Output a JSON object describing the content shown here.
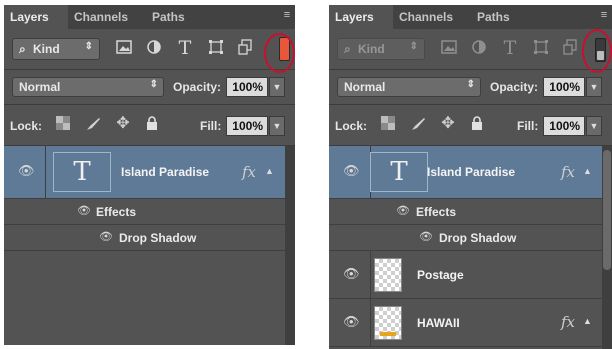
{
  "left_panel": {
    "tabs": [
      "Layers",
      "Channels",
      "Paths"
    ],
    "filter_kind": "Kind",
    "blend_mode": "Normal",
    "opacity_label": "Opacity:",
    "opacity_value": "100%",
    "lock_label": "Lock:",
    "fill_label": "Fill:",
    "fill_value": "100%",
    "layer_name": "Island Paradise",
    "fx_label": "fx",
    "effects_label": "Effects",
    "drop_shadow_label": "Drop Shadow"
  },
  "right_panel": {
    "tabs": [
      "Layers",
      "Channels",
      "Paths"
    ],
    "filter_kind": "Kind",
    "blend_mode": "Normal",
    "opacity_label": "Opacity:",
    "opacity_value": "100%",
    "lock_label": "Lock:",
    "fill_label": "Fill:",
    "fill_value": "100%",
    "layers": [
      {
        "name": "Island Paradise",
        "fx": "fx"
      },
      {
        "name": "Postage",
        "fx": ""
      },
      {
        "name": "HAWAII",
        "fx": "fx"
      }
    ],
    "effects_label": "Effects",
    "drop_shadow_label": "Drop Shadow"
  },
  "colors": {
    "panel_bg": "#535353",
    "selected_layer": "#5e7a96",
    "filter_toggle_on": "#e8573a",
    "highlight_ring": "#c8102e"
  },
  "icons": {
    "filter_types": [
      "pixel-filter-icon",
      "adjustment-filter-icon",
      "type-filter-icon",
      "shape-filter-icon",
      "smart-object-filter-icon"
    ],
    "lock_types": [
      "lock-transparent-icon",
      "lock-brush-icon",
      "lock-move-icon",
      "lock-all-icon"
    ]
  }
}
